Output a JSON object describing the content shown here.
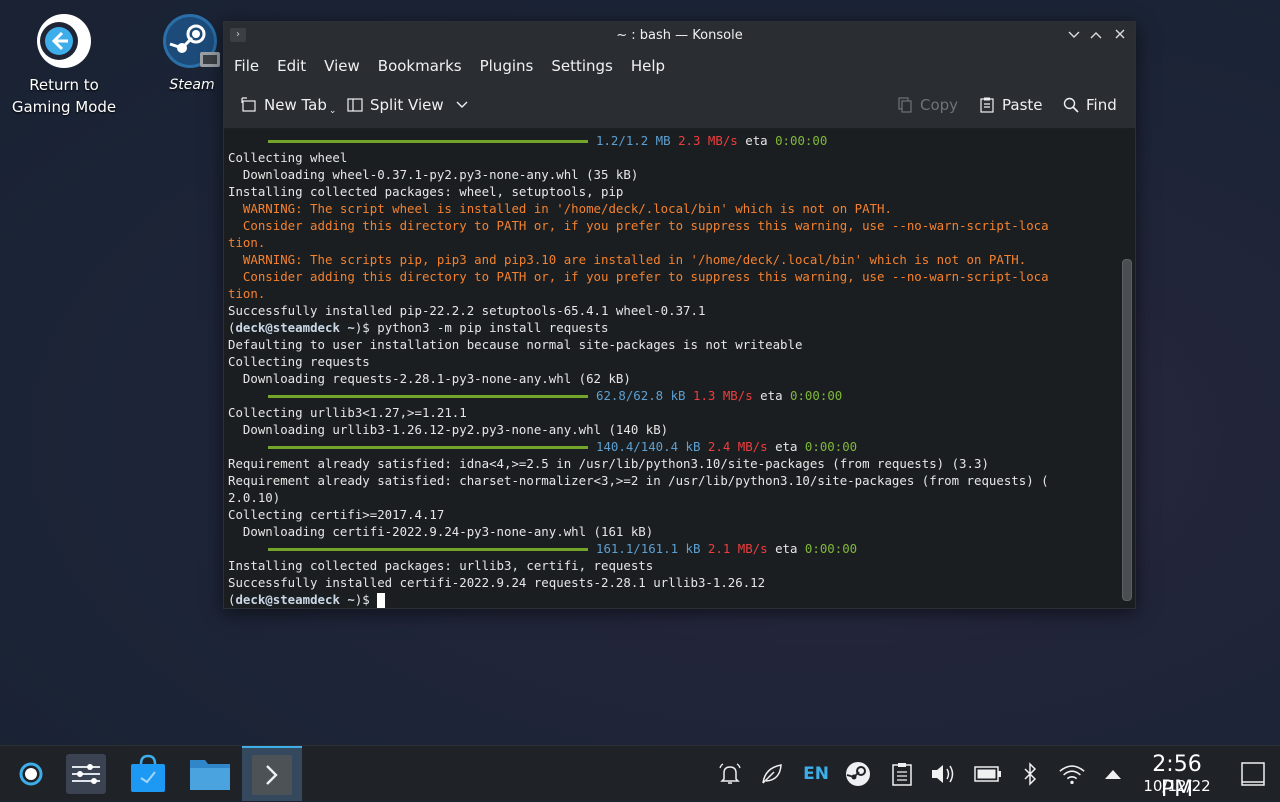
{
  "desktop": {
    "return_label_1": "Return to",
    "return_label_2": "Gaming Mode",
    "steam_label": "Steam"
  },
  "window": {
    "title": "~ : bash — Konsole",
    "menu": [
      "File",
      "Edit",
      "View",
      "Bookmarks",
      "Plugins",
      "Settings",
      "Help"
    ],
    "toolbar": {
      "new_tab": "New Tab",
      "split_view": "Split View",
      "copy": "Copy",
      "paste": "Paste",
      "find": "Find"
    }
  },
  "terminal": {
    "lines": [
      {
        "type": "progress",
        "size": "1.2/1.2 MB",
        "speed": "2.3 MB/s",
        "eta": "0:00:00"
      },
      {
        "type": "text",
        "text": "Collecting wheel"
      },
      {
        "type": "text",
        "text": "  Downloading wheel-0.37.1-py2.py3-none-any.whl (35 kB)"
      },
      {
        "type": "text",
        "text": "Installing collected packages: wheel, setuptools, pip"
      },
      {
        "type": "warn",
        "text": "  WARNING: The script wheel is installed in '/home/deck/.local/bin' which is not on PATH."
      },
      {
        "type": "warn",
        "text": "  Consider adding this directory to PATH or, if you prefer to suppress this warning, use --no-warn-script-loca"
      },
      {
        "type": "warn",
        "text": "tion."
      },
      {
        "type": "warn",
        "text": "  WARNING: The scripts pip, pip3 and pip3.10 are installed in '/home/deck/.local/bin' which is not on PATH."
      },
      {
        "type": "warn",
        "text": "  Consider adding this directory to PATH or, if you prefer to suppress this warning, use --no-warn-script-loca"
      },
      {
        "type": "warn",
        "text": "tion."
      },
      {
        "type": "text",
        "text": "Successfully installed pip-22.2.2 setuptools-65.4.1 wheel-0.37.1"
      },
      {
        "type": "prompt",
        "user": "deck@steamdeck",
        "dir": "~",
        "cmd": "python3 -m pip install requests"
      },
      {
        "type": "text",
        "text": "Defaulting to user installation because normal site-packages is not writeable"
      },
      {
        "type": "text",
        "text": "Collecting requests"
      },
      {
        "type": "text",
        "text": "  Downloading requests-2.28.1-py3-none-any.whl (62 kB)"
      },
      {
        "type": "progress",
        "size": "62.8/62.8 kB",
        "speed": "1.3 MB/s",
        "eta": "0:00:00"
      },
      {
        "type": "text",
        "text": "Collecting urllib3<1.27,>=1.21.1"
      },
      {
        "type": "text",
        "text": "  Downloading urllib3-1.26.12-py2.py3-none-any.whl (140 kB)"
      },
      {
        "type": "progress",
        "size": "140.4/140.4 kB",
        "speed": "2.4 MB/s",
        "eta": "0:00:00"
      },
      {
        "type": "text",
        "text": "Requirement already satisfied: idna<4,>=2.5 in /usr/lib/python3.10/site-packages (from requests) (3.3)"
      },
      {
        "type": "text",
        "text": "Requirement already satisfied: charset-normalizer<3,>=2 in /usr/lib/python3.10/site-packages (from requests) ("
      },
      {
        "type": "text",
        "text": "2.0.10)"
      },
      {
        "type": "text",
        "text": "Collecting certifi>=2017.4.17"
      },
      {
        "type": "text",
        "text": "  Downloading certifi-2022.9.24-py3-none-any.whl (161 kB)"
      },
      {
        "type": "progress",
        "size": "161.1/161.1 kB",
        "speed": "2.1 MB/s",
        "eta": "0:00:00"
      },
      {
        "type": "text",
        "text": "Installing collected packages: urllib3, certifi, requests"
      },
      {
        "type": "text",
        "text": "Successfully installed certifi-2022.9.24 requests-2.28.1 urllib3-1.26.12"
      },
      {
        "type": "prompt",
        "user": "deck@steamdeck",
        "dir": "~",
        "cmd": "",
        "cursor": true
      }
    ],
    "eta_label": "eta"
  },
  "taskbar": {
    "lang": "EN",
    "time": "2:56 PM",
    "date": "10/12/22"
  }
}
